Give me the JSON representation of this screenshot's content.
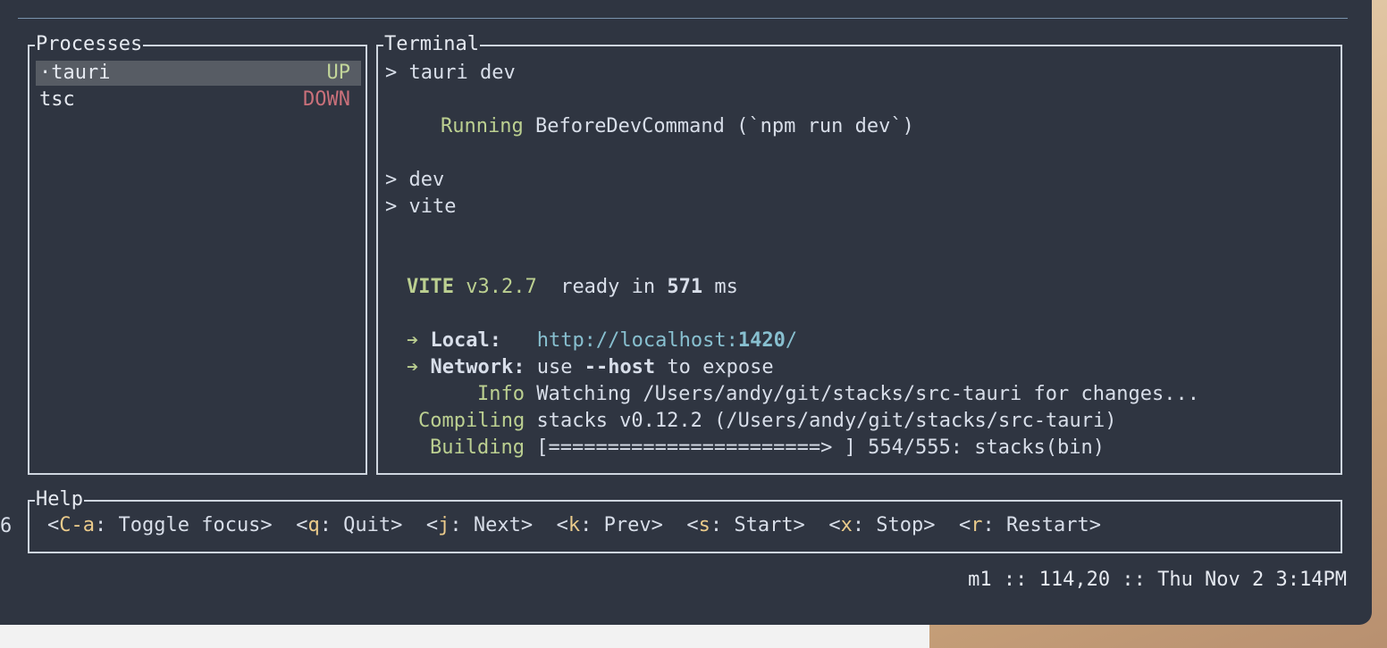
{
  "processes": {
    "title": "Processes",
    "items": [
      {
        "name": "tauri",
        "status": "UP",
        "marker": "·"
      },
      {
        "name": "tsc",
        "status": "DOWN",
        "marker": " "
      }
    ]
  },
  "terminal": {
    "title": "Terminal",
    "lines": {
      "l1": "> tauri dev",
      "running_kw": "Running",
      "running_text": " BeforeDevCommand (`npm run dev`)",
      "l3": "> dev",
      "l4": "> vite",
      "vite_name": "VITE",
      "vite_ver": " v3.2.7",
      "vite_ready": "  ready in ",
      "vite_ms": "571",
      "vite_unit": " ms",
      "local_label": " Local:",
      "local_url_pre": "   http://localhost:",
      "local_port": "1420",
      "local_url_post": "/",
      "network_label": " Network:",
      "network_text": " use ",
      "network_flag": "--host",
      "network_end": " to expose",
      "info_kw": "Info",
      "info_text": " Watching /Users/andy/git/stacks/src-tauri for changes...",
      "compiling_kw": "Compiling",
      "compiling_text": " stacks v0.12.2 (/Users/andy/git/stacks/src-tauri)",
      "building_kw": "Building",
      "building_text": " [=======================> ] 554/555: stacks(bin)"
    }
  },
  "help": {
    "title": "Help",
    "items": [
      {
        "key": "C-a",
        "label": ": Toggle focus>"
      },
      {
        "key": "q",
        "label": ": Quit>"
      },
      {
        "key": "j",
        "label": ": Next>"
      },
      {
        "key": "k",
        "label": ": Prev>"
      },
      {
        "key": "s",
        "label": ": Start>"
      },
      {
        "key": "x",
        "label": ": Stop>"
      },
      {
        "key": "r",
        "label": ": Restart>"
      }
    ]
  },
  "statusbar": {
    "text": "m1 :: 114,20 :: Thu Nov 2 3:14PM",
    "left_digit": "6"
  },
  "colors": {
    "up": "#c2d59a",
    "down": "#c9707a",
    "key": "#ebcb8b",
    "url": "#88c0d0"
  }
}
